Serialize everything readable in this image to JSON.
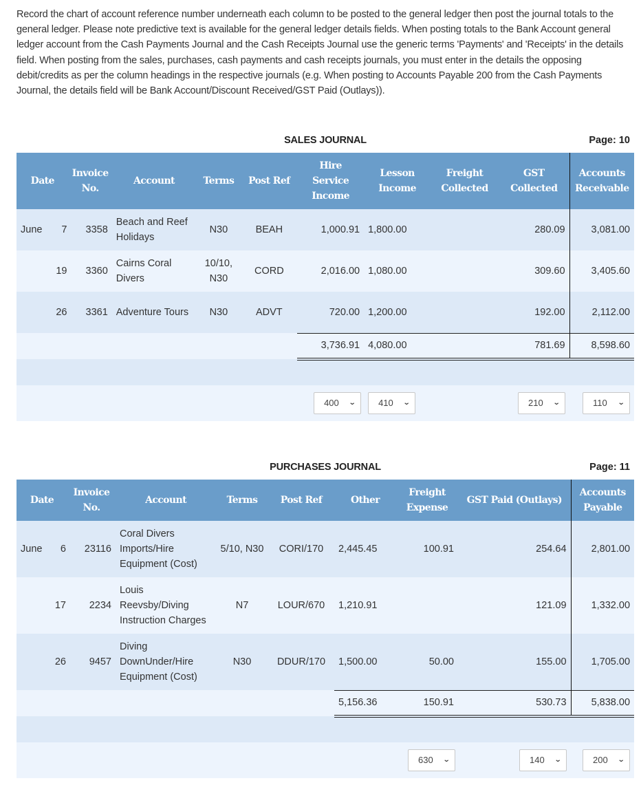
{
  "instructions": "Record the chart of account reference number underneath each column to be posted to the general ledger then post the journal totals to the general ledger. Please note predictive text is available for the general ledger details fields. When posting totals to the Bank Account general ledger account from the Cash Payments Journal and the Cash Receipts Journal use the generic terms 'Payments' and 'Receipts' in the details field. When posting from the sales, purchases, cash payments and cash receipts journals, you must enter in the details the opposing debit/credits as per the column headings in the respective journals (e.g. When posting to Accounts Payable 200 from the Cash Payments Journal, the details field will be Bank Account/Discount Received/GST Paid (Outlays)).",
  "sales": {
    "title": "SALES JOURNAL",
    "page": "Page: 10",
    "headers": [
      "Date",
      "Invoice No.",
      "Account",
      "Terms",
      "Post Ref",
      "Hire Service Income",
      "Lesson Income",
      "Freight Collected",
      "GST Collected",
      "Accounts Receivable"
    ],
    "rows": [
      {
        "month": "June",
        "day": "7",
        "invoice": "3358",
        "account": "Beach and Reef Holidays",
        "terms": "N30",
        "post_ref": "BEAH",
        "hire": "1,000.91",
        "lesson": "1,800.00",
        "freight": "",
        "gst": "280.09",
        "ar": "3,081.00"
      },
      {
        "month": "",
        "day": "19",
        "invoice": "3360",
        "account": "Cairns Coral Divers",
        "terms": "10/10, N30",
        "post_ref": "CORD",
        "hire": "2,016.00",
        "lesson": "1,080.00",
        "freight": "",
        "gst": "309.60",
        "ar": "3,405.60"
      },
      {
        "month": "",
        "day": "26",
        "invoice": "3361",
        "account": "Adventure Tours",
        "terms": "N30",
        "post_ref": "ADVT",
        "hire": "720.00",
        "lesson": "1,200.00",
        "freight": "",
        "gst": "192.00",
        "ar": "2,112.00"
      }
    ],
    "totals": {
      "hire": "3,736.91",
      "lesson": "4,080.00",
      "freight": "",
      "gst": "781.69",
      "ar": "8,598.60"
    },
    "refs": {
      "hire": "400",
      "lesson": "410",
      "gst": "210",
      "ar": "110"
    }
  },
  "purchases": {
    "title": "PURCHASES JOURNAL",
    "page": "Page: 11",
    "headers": [
      "Date",
      "Invoice No.",
      "Account",
      "Terms",
      "Post Ref",
      "Other",
      "Freight Expense",
      "GST Paid (Outlays)",
      "Accounts Payable"
    ],
    "rows": [
      {
        "month": "June",
        "day": "6",
        "invoice": "23116",
        "account": "Coral Divers Imports/Hire Equipment (Cost)",
        "terms": "5/10, N30",
        "post_ref": "CORI/170",
        "other": "2,445.45",
        "freight": "100.91",
        "gst": "254.64",
        "ap": "2,801.00"
      },
      {
        "month": "",
        "day": "17",
        "invoice": "2234",
        "account": "Louis Reevsby/Diving Instruction Charges",
        "terms": "N7",
        "post_ref": "LOUR/670",
        "other": "1,210.91",
        "freight": "",
        "gst": "121.09",
        "ap": "1,332.00"
      },
      {
        "month": "",
        "day": "26",
        "invoice": "9457",
        "account": "Diving DownUnder/Hire Equipment (Cost)",
        "terms": "N30",
        "post_ref": "DDUR/170",
        "other": "1,500.00",
        "freight": "50.00",
        "gst": "155.00",
        "ap": "1,705.00"
      }
    ],
    "totals": {
      "other": "5,156.36",
      "freight": "150.91",
      "gst": "530.73",
      "ap": "5,838.00"
    },
    "refs": {
      "freight": "630",
      "gst": "140",
      "ap": "200"
    }
  },
  "icons": {
    "select_chevron": "chevron-down-icon"
  }
}
